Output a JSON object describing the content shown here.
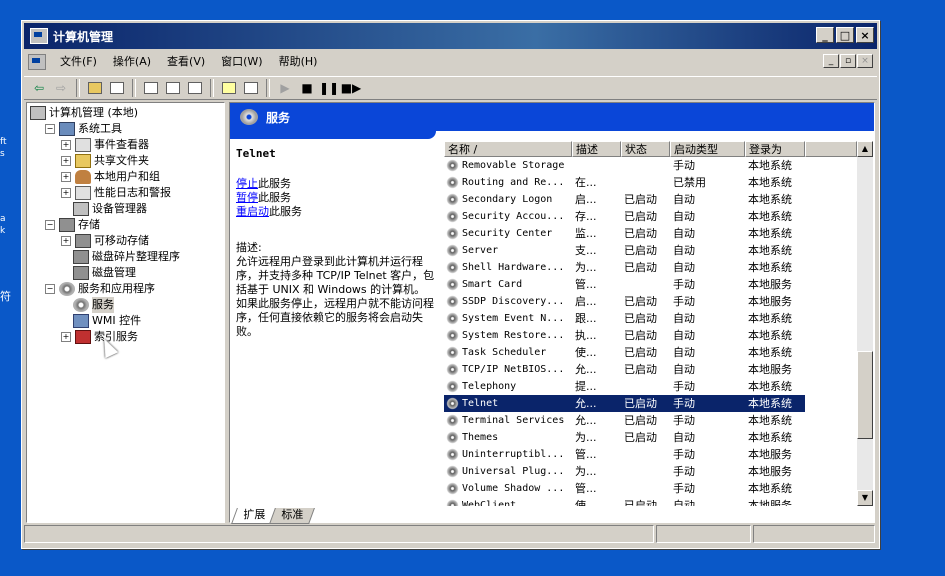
{
  "desktop_edge": [
    "ft",
    "s",
    "a",
    "k",
    "符"
  ],
  "window": {
    "title": "计算机管理",
    "buttons": [
      "_",
      "□",
      "×"
    ]
  },
  "menu": [
    "文件(F)",
    "操作(A)",
    "查看(V)",
    "窗口(W)",
    "帮助(H)"
  ],
  "tree": {
    "root": "计算机管理 (本地)",
    "items": [
      {
        "label": "系统工具",
        "icon": "tools-icon",
        "exp": "−"
      },
      {
        "label": "事件查看器",
        "icon": "event-viewer-icon",
        "exp": "+"
      },
      {
        "label": "共享文件夹",
        "icon": "shared-folder-icon",
        "exp": "+"
      },
      {
        "label": "本地用户和组",
        "icon": "users-icon",
        "exp": "+"
      },
      {
        "label": "性能日志和警报",
        "icon": "performance-icon",
        "exp": "+"
      },
      {
        "label": "设备管理器",
        "icon": "device-manager-icon",
        "exp": ""
      },
      {
        "label": "存储",
        "icon": "storage-icon",
        "exp": "−"
      },
      {
        "label": "可移动存储",
        "icon": "removable-storage-icon",
        "exp": "+"
      },
      {
        "label": "磁盘碎片整理程序",
        "icon": "defrag-icon",
        "exp": ""
      },
      {
        "label": "磁盘管理",
        "icon": "disk-management-icon",
        "exp": ""
      },
      {
        "label": "服务和应用程序",
        "icon": "services-apps-icon",
        "exp": "−"
      },
      {
        "label": "服务",
        "icon": "services-icon",
        "exp": ""
      },
      {
        "label": "WMI 控件",
        "icon": "wmi-icon",
        "exp": ""
      },
      {
        "label": "索引服务",
        "icon": "indexing-icon",
        "exp": "+"
      }
    ]
  },
  "banner": {
    "title": "服务"
  },
  "description": {
    "service_name": "Telnet",
    "link_stop": "停止",
    "text_stop": "此服务",
    "link_pause": "暂停",
    "text_pause": "此服务",
    "link_restart": "重启动",
    "text_restart": "此服务",
    "label": "描述:",
    "body": "允许远程用户登录到此计算机并运行程序，并支持多种 TCP/IP Telnet 客户，包括基于 UNIX 和 Windows 的计算机。如果此服务停止，远程用户就不能访问程序，任何直接依赖它的服务将会启动失败。"
  },
  "columns": [
    "名称 /",
    "描述",
    "状态",
    "启动类型",
    "登录为"
  ],
  "services": [
    {
      "name": "Removable Storage",
      "desc": "",
      "status": "",
      "startup": "手动",
      "logon": "本地系统"
    },
    {
      "name": "Routing and Re...",
      "desc": "在...",
      "status": "",
      "startup": "已禁用",
      "logon": "本地系统"
    },
    {
      "name": "Secondary Logon",
      "desc": "启...",
      "status": "已启动",
      "startup": "自动",
      "logon": "本地系统"
    },
    {
      "name": "Security Accou...",
      "desc": "存...",
      "status": "已启动",
      "startup": "自动",
      "logon": "本地系统"
    },
    {
      "name": "Security Center",
      "desc": "监...",
      "status": "已启动",
      "startup": "自动",
      "logon": "本地系统"
    },
    {
      "name": "Server",
      "desc": "支...",
      "status": "已启动",
      "startup": "自动",
      "logon": "本地系统"
    },
    {
      "name": "Shell Hardware...",
      "desc": "为...",
      "status": "已启动",
      "startup": "自动",
      "logon": "本地系统"
    },
    {
      "name": "Smart Card",
      "desc": "管...",
      "status": "",
      "startup": "手动",
      "logon": "本地服务"
    },
    {
      "name": "SSDP Discovery...",
      "desc": "启...",
      "status": "已启动",
      "startup": "手动",
      "logon": "本地服务"
    },
    {
      "name": "System Event N...",
      "desc": "跟...",
      "status": "已启动",
      "startup": "自动",
      "logon": "本地系统"
    },
    {
      "name": "System Restore...",
      "desc": "执...",
      "status": "已启动",
      "startup": "自动",
      "logon": "本地系统"
    },
    {
      "name": "Task Scheduler",
      "desc": "使...",
      "status": "已启动",
      "startup": "自动",
      "logon": "本地系统"
    },
    {
      "name": "TCP/IP NetBIOS...",
      "desc": "允...",
      "status": "已启动",
      "startup": "自动",
      "logon": "本地服务"
    },
    {
      "name": "Telephony",
      "desc": "提...",
      "status": "",
      "startup": "手动",
      "logon": "本地系统"
    },
    {
      "name": "Telnet",
      "desc": "允...",
      "status": "已启动",
      "startup": "手动",
      "logon": "本地系统",
      "selected": true
    },
    {
      "name": "Terminal Services",
      "desc": "允...",
      "status": "已启动",
      "startup": "手动",
      "logon": "本地系统"
    },
    {
      "name": "Themes",
      "desc": "为...",
      "status": "已启动",
      "startup": "自动",
      "logon": "本地系统"
    },
    {
      "name": "Uninterruptibl...",
      "desc": "管...",
      "status": "",
      "startup": "手动",
      "logon": "本地服务"
    },
    {
      "name": "Universal Plug...",
      "desc": "为...",
      "status": "",
      "startup": "手动",
      "logon": "本地服务"
    },
    {
      "name": "Volume Shadow ...",
      "desc": "管...",
      "status": "",
      "startup": "手动",
      "logon": "本地系统"
    },
    {
      "name": "WebClient",
      "desc": "使...",
      "status": "已启动",
      "startup": "自动",
      "logon": "本地服务"
    }
  ],
  "tabs": [
    "扩展",
    "标准"
  ]
}
